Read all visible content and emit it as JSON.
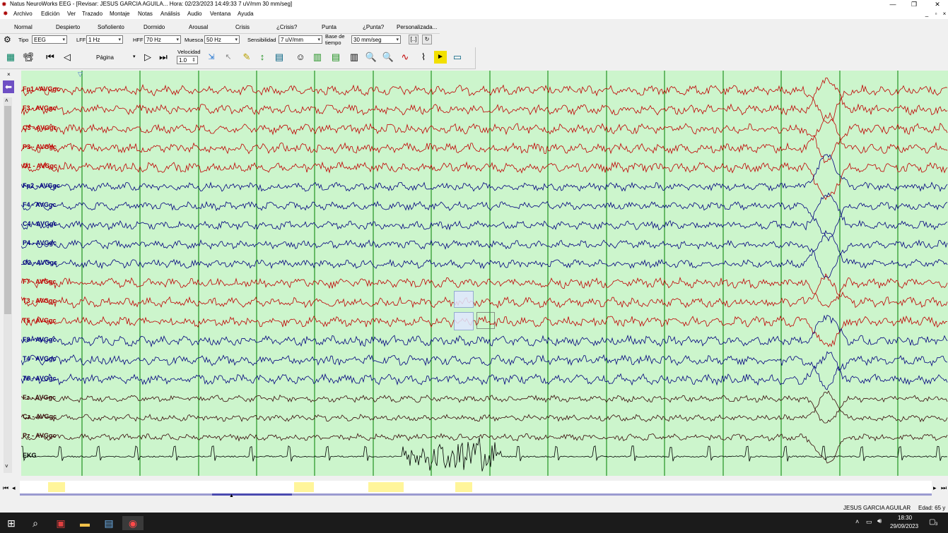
{
  "window": {
    "title": "Natus NeuroWorks EEG - [Revisar:  JESUS  GARCIA AGUILA...  Hora: 02/23/2023 14:49:33   7 uV/mm   30 mm/seg]",
    "min": "—",
    "max": "❐",
    "close": "✕"
  },
  "menu": [
    "Archivo",
    "Edición",
    "Ver",
    "Trazado",
    "Montaje",
    "Notas",
    "Análisis",
    "Audio",
    "Ventana",
    "Ayuda"
  ],
  "mdi_controls": [
    "_",
    "▫",
    "×"
  ],
  "stages": [
    "Normal",
    "Despierto",
    "Soñoliento",
    "Dormido",
    "Arousal",
    "Crisis",
    "¿Crisis?",
    "Punta",
    "¿Punta?",
    "Personalizada..."
  ],
  "settings": {
    "tipo_label": "Tipo",
    "tipo_value": "EEG",
    "lff_label": "LFF",
    "lff_value": "1 Hz",
    "hff_label": "HFF",
    "hff_value": "70 Hz",
    "muesca_label": "Muesca",
    "muesca_value": "50 Hz",
    "sens_label": "Sensibilidad",
    "sens_value": "7 uV/mm",
    "base_label_1": "Base de",
    "base_label_2": "tiempo",
    "base_value": "30 mm/seg",
    "bracket_btn": "[..]"
  },
  "toolbar": {
    "page_label": "Página",
    "speed_label": "Velocidad",
    "speed_value": "1.0"
  },
  "channels": [
    {
      "name": "Fp1 - AVGgc",
      "color": "#c00000"
    },
    {
      "name": "F3 - AVGgc",
      "color": "#c00000"
    },
    {
      "name": "C3 - AVGgc",
      "color": "#c00000"
    },
    {
      "name": "P3 - AVGgc",
      "color": "#c00000"
    },
    {
      "name": "O1 - AVGgc",
      "color": "#c00000"
    },
    {
      "name": "Fp2 - AVGgc",
      "color": "#00007f"
    },
    {
      "name": "F4 - AVGgc",
      "color": "#00007f"
    },
    {
      "name": "C4 - AVGgc",
      "color": "#00007f"
    },
    {
      "name": "P4 - AVGgc",
      "color": "#00007f"
    },
    {
      "name": "O2 - AVGgc",
      "color": "#00007f"
    },
    {
      "name": "F7 - AVGgc",
      "color": "#c00000"
    },
    {
      "name": "T3 - AVGgc",
      "color": "#c00000"
    },
    {
      "name": "T5 - AVGgc",
      "color": "#c00000"
    },
    {
      "name": "F8 - AVGgc",
      "color": "#00007f"
    },
    {
      "name": "T4 - AVGgc",
      "color": "#00007f"
    },
    {
      "name": "T6 - AVGgc",
      "color": "#00007f"
    },
    {
      "name": "Fz - AVGgc",
      "color": "#3a0a0a"
    },
    {
      "name": "Cz - AVGgc",
      "color": "#3a0a0a"
    },
    {
      "name": "Pz - AVGgc",
      "color": "#3a0a0a"
    },
    {
      "name": "EKG",
      "color": "#000000"
    }
  ],
  "colors": {
    "eeg_background": "#ccf5cc",
    "second_marker": "#008000",
    "left_hemisphere": "#c00000",
    "right_hemisphere": "#00007f",
    "midline": "#3a0a0a",
    "timeline_highlight": "#fff59a"
  },
  "status": {
    "patient": "JESUS  GARCIA AGUILAR",
    "age": "Edad: 65 y"
  },
  "taskbar": {
    "time": "18:30",
    "date": "29/09/2023",
    "notifications": "3"
  }
}
